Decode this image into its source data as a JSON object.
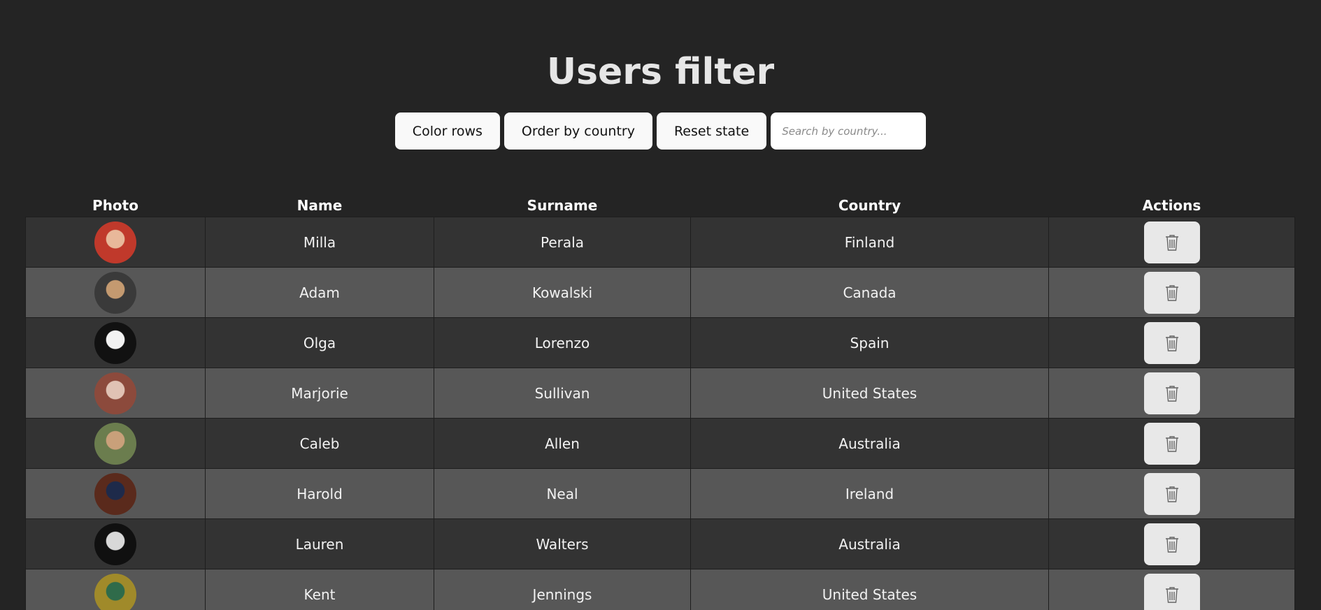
{
  "title": "Users filter",
  "toolbar": {
    "color_rows": "Color rows",
    "order_by_country": "Order by country",
    "reset_state": "Reset state",
    "search_placeholder": "Search by country..."
  },
  "table": {
    "headers": [
      "Photo",
      "Name",
      "Surname",
      "Country",
      "Actions"
    ],
    "rows": [
      {
        "name": "Milla",
        "surname": "Perala",
        "country": "Finland",
        "avatar_colors": [
          "#c0392b",
          "#e8b89a"
        ]
      },
      {
        "name": "Adam",
        "surname": "Kowalski",
        "country": "Canada",
        "avatar_colors": [
          "#3a3a3a",
          "#c49a70"
        ]
      },
      {
        "name": "Olga",
        "surname": "Lorenzo",
        "country": "Spain",
        "avatar_colors": [
          "#111111",
          "#f2f2f2"
        ]
      },
      {
        "name": "Marjorie",
        "surname": "Sullivan",
        "country": "United States",
        "avatar_colors": [
          "#8c4a3c",
          "#e0c2b4"
        ]
      },
      {
        "name": "Caleb",
        "surname": "Allen",
        "country": "Australia",
        "avatar_colors": [
          "#6b7d4e",
          "#c9a07a"
        ]
      },
      {
        "name": "Harold",
        "surname": "Neal",
        "country": "Ireland",
        "avatar_colors": [
          "#5a2a1c",
          "#1e2a4a"
        ]
      },
      {
        "name": "Lauren",
        "surname": "Walters",
        "country": "Australia",
        "avatar_colors": [
          "#101010",
          "#d8d8d8"
        ]
      },
      {
        "name": "Kent",
        "surname": "Jennings",
        "country": "United States",
        "avatar_colors": [
          "#a08a2a",
          "#2f6b4a"
        ]
      }
    ]
  },
  "icons": {
    "delete": "trash-icon"
  },
  "colors": {
    "background": "#242424",
    "row_odd": "#333333",
    "row_even": "#575757",
    "button_bg": "#f9f9f9",
    "delete_bg": "#e8e8e8"
  }
}
